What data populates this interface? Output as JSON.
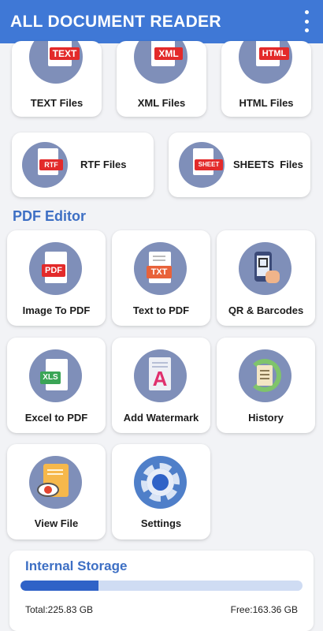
{
  "app": {
    "title": "ALL DOCUMENT READER"
  },
  "file_types": [
    {
      "label": "TEXT Files",
      "badge": "TEXT",
      "icon": "text-file-icon"
    },
    {
      "label": "XML Files",
      "badge": "XML",
      "icon": "xml-file-icon"
    },
    {
      "label": "HTML Files",
      "badge": "HTML",
      "icon": "html-file-icon"
    },
    {
      "label": "RTF Files",
      "badge": "RTF",
      "icon": "rtf-file-icon"
    },
    {
      "label": "SHEETS  Files",
      "badge": "SHEET",
      "icon": "sheet-file-icon"
    }
  ],
  "pdf_editor": {
    "title": "PDF Editor",
    "tools": [
      {
        "label": "Image To PDF",
        "badge": "PDF",
        "icon": "pdf-file-icon"
      },
      {
        "label": "Text to PDF",
        "badge": "TXT",
        "icon": "txt-file-icon"
      },
      {
        "label": "QR & Barcodes",
        "icon": "qr-scan-phone-icon"
      },
      {
        "label": "Excel to PDF",
        "badge": "XLS",
        "icon": "xls-file-icon"
      },
      {
        "label": "Add Watermark",
        "badge": "A",
        "icon": "watermark-icon"
      },
      {
        "label": "History",
        "icon": "history-icon"
      },
      {
        "label": "View File",
        "icon": "view-file-eye-icon"
      },
      {
        "label": "Settings",
        "icon": "gear-icon"
      }
    ]
  },
  "storage": {
    "title": "Internal Storage",
    "total": "Total:225.83 GB",
    "free": "Free:163.36 GB",
    "used_fraction": 0.277
  },
  "colors": {
    "appbar": "#3f78d6",
    "accent": "#3d6fc4",
    "icon_circle": "#7f8fb9",
    "badge_red": "#e32a2a",
    "badge_green": "#3aa556"
  }
}
